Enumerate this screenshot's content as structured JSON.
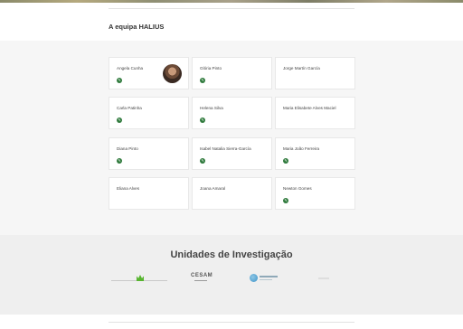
{
  "team": {
    "title": "A equipa HALIUS",
    "members": [
      {
        "name": "Angela Cunha",
        "has_icon": true,
        "has_avatar": true
      },
      {
        "name": "Glória Pinto",
        "has_icon": true,
        "has_avatar": false
      },
      {
        "name": "Jorge Martín García",
        "has_icon": false,
        "has_avatar": false
      },
      {
        "name": "Carla Patinha",
        "has_icon": true,
        "has_avatar": false
      },
      {
        "name": "Helena Silva",
        "has_icon": true,
        "has_avatar": false
      },
      {
        "name": "Maria Elisabete Alves Maciel",
        "has_icon": false,
        "has_avatar": false
      },
      {
        "name": "Diana Pinto",
        "has_icon": true,
        "has_avatar": false
      },
      {
        "name": "Isabel Natalia Sierra-García",
        "has_icon": true,
        "has_avatar": false
      },
      {
        "name": "Maria João Ferreira",
        "has_icon": true,
        "has_avatar": false
      },
      {
        "name": "Eliana Alves",
        "has_icon": false,
        "has_avatar": false
      },
      {
        "name": "Joana Amaral",
        "has_icon": false,
        "has_avatar": false
      },
      {
        "name": "Newton Gomes",
        "has_icon": true,
        "has_avatar": false
      }
    ],
    "icon_glyph": "✎",
    "icon_name": "researcher-profile-icon",
    "icon_color": "#2f7a3c"
  },
  "units": {
    "title": "Unidades de Investigação",
    "logos": [
      {
        "name": "research-unit-logo-crown"
      },
      {
        "name": "cesam-logo",
        "text": "CESAM"
      },
      {
        "name": "research-unit-logo-globe"
      },
      {
        "name": "research-unit-logo-faint"
      }
    ]
  },
  "colors": {
    "section_bg": "#f6f6f6",
    "units_bg": "#efefef",
    "accent_green": "#2f7a3c",
    "crown_green": "#57b52f"
  }
}
